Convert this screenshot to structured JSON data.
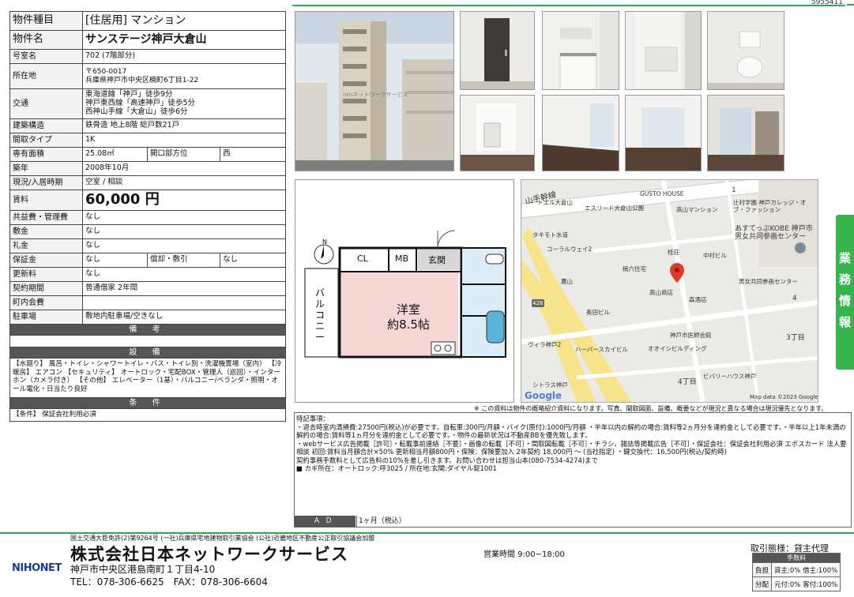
{
  "ref_no": "5955411",
  "property": {
    "type_label": "物件種目",
    "type_value": "[住居用] マンション",
    "name_label": "物件名",
    "name_value": "サンステージ神戸大倉山",
    "room_label": "号室名",
    "room_value": "702 (7階部分)",
    "address_label": "所在地",
    "address_value": "〒650-0017\n兵庫県神戸市中央区楠町6丁目1-22",
    "transport_label": "交通",
    "transport_value": "東海道線「神戸」徒歩9分\n神戸東西線「高速神戸」徒歩5分\n西神山手線「大倉山」徒歩6分",
    "structure_label": "建築構造",
    "structure_value": "鉄骨造 地上8階 総戸数21戸",
    "layout_label": "間取タイプ",
    "layout_value": "1K",
    "area_label": "専有面積",
    "area_value": "25.08㎡",
    "opening_label": "開口部方位",
    "opening_value": "西",
    "built_label": "築年",
    "built_value": "2008年10月",
    "status_label": "現況/入居時期",
    "status_value": "空室 / 相談",
    "rent_label": "賃料",
    "rent_value": "60,000 円",
    "common_label": "共益費・管理費",
    "common_value": "なし",
    "shikikin_label": "敷金",
    "shikikin_value": "なし",
    "reikin_label": "礼金",
    "reikin_value": "なし",
    "hoshokin_label": "保証金",
    "hoshokin_value": "なし",
    "shokyaku_label": "償却・敷引",
    "shokyaku_value": "なし",
    "renewal_label": "更新料",
    "renewal_value": "なし",
    "contract_label": "契約期間",
    "contract_value": "普通借家 2年間",
    "town_label": "町内会費",
    "town_value": "",
    "parking_label": "駐車場",
    "parking_value": "敷地内駐車場/空きなし",
    "remarks_header": "備 考",
    "facility_header": "設 備",
    "facility_text": "【水廻り】 風呂・トイレ・シャワートイレ・バス・トイレ別・洗濯機置場（室内） 【冷暖房】 エアコン 【セキュリティ】 オートロック・宅配BOX・管理人（巡回）・インターホン（カメラ付き） 【その他】 エレベーター（1基）・バルコニー/ベランダ・照明・オール電化・日当たり良好",
    "conditions_header": "条 件",
    "conditions_text": "【条件】 保証会社利用必須"
  },
  "photos": {
    "watermark": "nnsネットワークサービス"
  },
  "floorplan": {
    "cl": "CL",
    "mb": "MB",
    "entry": "玄関",
    "room": "洋室",
    "room_size": "約8.5帖",
    "balcony": "バルコニー",
    "compass": "N"
  },
  "map": {
    "labels": [
      "山手幹線",
      "トエル大倉山",
      "エスリード大倉山公園",
      "GUSTO HOUSE",
      "高山マンション",
      "辻村学園 神戸カレッジ・オブ・ファッション",
      "あすてっぷKOBE 神戸市男女共同参画センター",
      "タキモト水道",
      "コーラルウェイ2",
      "桂荘",
      "中村ビル",
      "楠六住宅",
      "男女共同参画センター",
      "鷹山",
      "高山商店",
      "森酒店",
      "428",
      "奥田ビル",
      "神戸市医師会館",
      "ヴィラ神戸2",
      "ハーバースカイビル",
      "オオイシビルディング",
      "3丁目",
      "シトラス神戸",
      "4丁目",
      "ビバリーハウス神戸",
      "1",
      "4",
      "Map data ©2023 Google"
    ],
    "google": "Google"
  },
  "side_tab": "業務情報",
  "disclaimer": "※ この資料は物件の概略紹介資料になります。写真、間取図面、設備、概要などが現況と異なる場合は現況優先となります。",
  "notes": {
    "text": "特記事項：\n・退去時室内清掃費:27500円(税込)が必要です。自転車:300円/月額・バイク(原付):1000円/月額 ・半年以内の解約の場合:賃料等2ヵ月分を違約金として必要です。・半年以上1年未満の解約の場合:賃料等1ヵ月分を違約金として必要です。・物件の最新状況は不動産BBを優先致します。\n・webサービス広告掲載［許可］・転載事前連絡［不要］・画像の転載［不可］・間取図転載［不可］・チラシ、雑誌等掲載広告［不可］・保証会社：保証会社利用必須 エポスカード 法人要相談 初回:賃料当月額合計×50% 更新相当月額800円・保険：保険要加入 2年契約 18,000円 ～ (当社指定) ・鍵交換代：16,500円(税込/契約時)\n契約事務手数料として広告料の10%を差し引きます。お問い合わせは担当山本(080-7534-4274)まで\n■ カギ所在：オートロック:呼3025 / 所在地:玄関:ダイヤル錠1001",
    "ad_label": "ＡＤ",
    "ad_value": "1ヶ月（税込）"
  },
  "footer": {
    "license": "国土交通大臣免許(2)第9264号 (一社)兵庫県宅地建物取引業協会 (公社)近畿地区不動産公正取引協議会加盟",
    "company": "株式会社日本ネットワークサービス",
    "address": "神戸市中央区港島南町１丁目4-10",
    "tel": "TEL：078-306-6625　FAX：078-306-6604",
    "hours": "営業時間 9:00~18:00",
    "logo": "NIHONET",
    "mode": "取引態様：貸主代理",
    "fee_header": "手数料",
    "burden_label": "負担",
    "burden_value": "貸主:0% 借主:100%",
    "split_label": "分配",
    "split_value": "元付:0% 客付:100%"
  },
  "colors": {
    "accent": "#2ea84a",
    "header_gray": "#555555",
    "logo_blue": "#1a3d8f"
  }
}
